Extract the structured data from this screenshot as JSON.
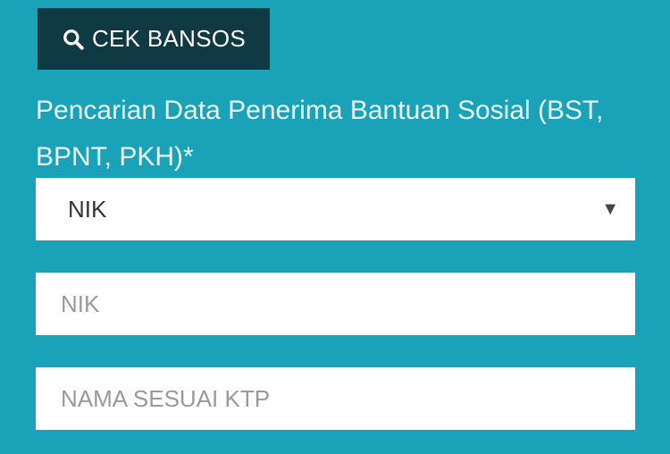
{
  "button": {
    "label": "CEK BANSOS",
    "icon": "search-icon"
  },
  "heading": {
    "text": "Pencarian Data Penerima Bantuan Sosial (BST, BPNT, PKH)*"
  },
  "search_type": {
    "selected": "NIK"
  },
  "nik_field": {
    "placeholder": "NIK",
    "value": ""
  },
  "nama_field": {
    "placeholder": "NAMA SESUAI KTP",
    "value": ""
  },
  "colors": {
    "background": "#1aa3b8",
    "button": "#0f3a44",
    "field": "#ffffff"
  }
}
